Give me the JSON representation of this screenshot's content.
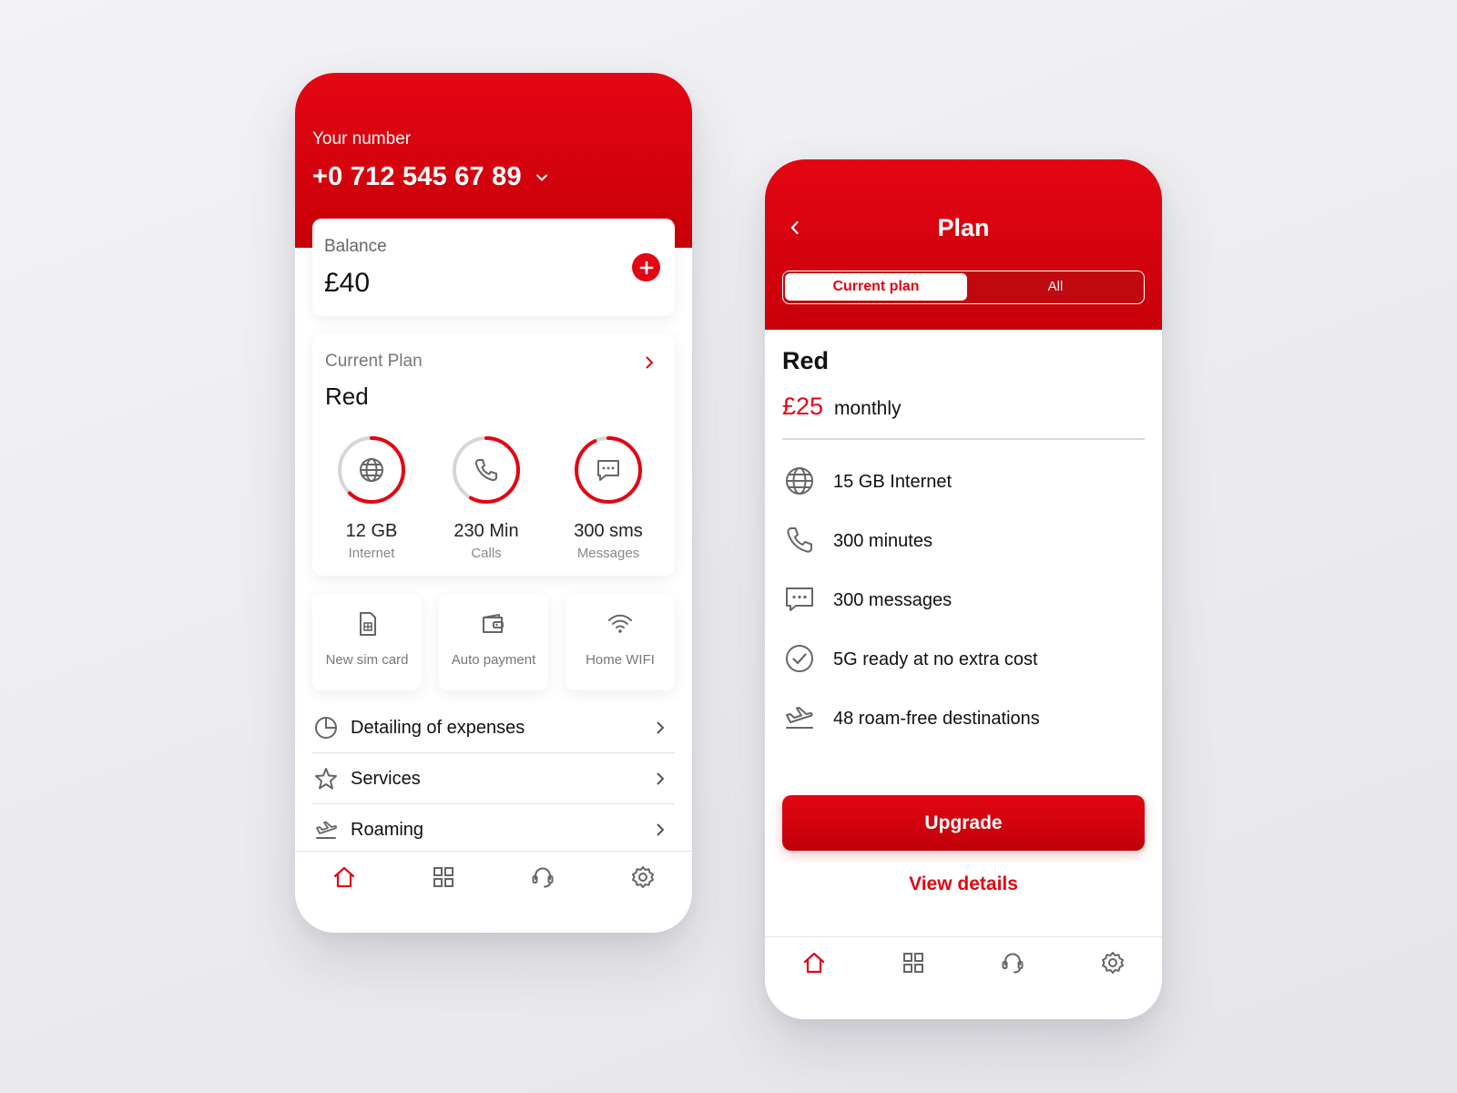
{
  "colors": {
    "brand_red": "#e30613",
    "text_dark": "#111111",
    "text_muted": "#777777",
    "icon_gray": "#666666"
  },
  "home_screen": {
    "number_label": "Your number",
    "number_value": "+0 712 545 67 89",
    "balance": {
      "label": "Balance",
      "value": "£40",
      "add_icon": "plus-circle-icon"
    },
    "current_plan": {
      "label": "Current Plan",
      "name": "Red",
      "usage": [
        {
          "value": "12 GB",
          "label": "Internet",
          "icon": "globe-icon",
          "progress": 0.62
        },
        {
          "value": "230 Min",
          "label": "Calls",
          "icon": "phone-icon",
          "progress": 0.58
        },
        {
          "value": "300 sms",
          "label": "Messages",
          "icon": "message-icon",
          "progress": 0.93
        }
      ]
    },
    "quick_actions": [
      {
        "label": "New sim card",
        "icon": "sim-card-icon"
      },
      {
        "label": "Auto payment",
        "icon": "wallet-icon"
      },
      {
        "label": "Home WIFI",
        "icon": "wifi-icon"
      }
    ],
    "menu": [
      {
        "label": "Detailing of expenses",
        "icon": "pie-chart-icon"
      },
      {
        "label": "Services",
        "icon": "star-icon"
      },
      {
        "label": "Roaming",
        "icon": "plane-icon"
      }
    ]
  },
  "plan_screen": {
    "title": "Plan",
    "segments": {
      "active": "Current plan",
      "inactive": "All"
    },
    "plan_name": "Red",
    "price": "£25",
    "period": "monthly",
    "features": [
      {
        "label": "15 GB Internet",
        "icon": "globe-icon"
      },
      {
        "label": "300 minutes",
        "icon": "phone-icon"
      },
      {
        "label": "300 messages",
        "icon": "message-icon"
      },
      {
        "label": "5G ready at no extra cost",
        "icon": "check-circle-icon"
      },
      {
        "label": "48 roam-free destinations",
        "icon": "plane-icon"
      }
    ],
    "primary_button": "Upgrade",
    "secondary_link": "View details"
  },
  "tab_bar": {
    "active": "home",
    "items": [
      "home-icon",
      "grid-icon",
      "support-icon",
      "settings-icon"
    ]
  }
}
